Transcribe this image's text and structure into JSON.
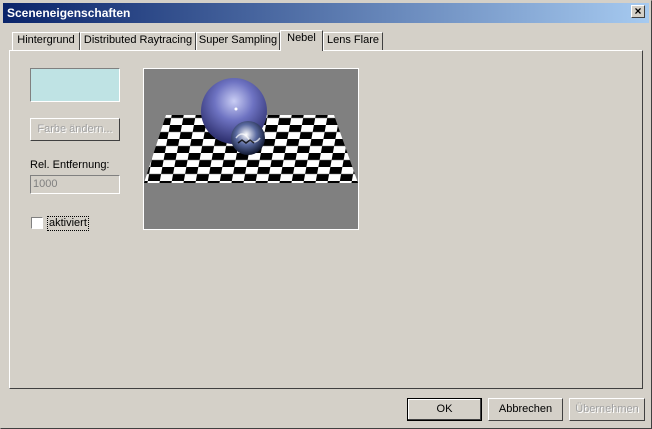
{
  "window": {
    "title": "Sceneneigenschaften",
    "close_glyph": "×"
  },
  "tabs": [
    {
      "label": "Hintergrund"
    },
    {
      "label": "Distributed Raytracing"
    },
    {
      "label": "Super Sampling"
    },
    {
      "label": "Nebel"
    },
    {
      "label": "Lens Flare"
    }
  ],
  "active_tab": "Nebel",
  "fog": {
    "color_hex": "#bfe3e4",
    "change_color_label": "Farbe ändern...",
    "distance_label": "Rel. Entfernung:",
    "distance_value": "1000",
    "enabled_label": "aktiviert",
    "enabled": false
  },
  "buttons": {
    "ok": "OK",
    "cancel": "Abbrechen",
    "apply": "Übernehmen"
  }
}
